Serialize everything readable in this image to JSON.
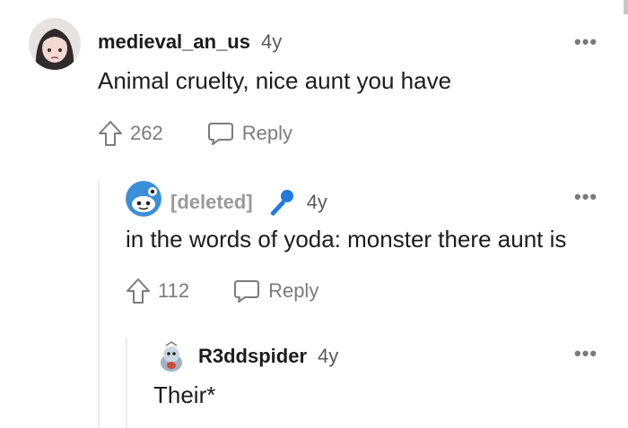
{
  "colors": {
    "text": "#1c1c1c",
    "meta": "#5b5b5b",
    "action": "#7c7c7c",
    "deleted": "#9a9a9a",
    "mic": "#1f7ae0",
    "thread_line": "#ededed"
  },
  "comments": [
    {
      "username": "medieval_an_us",
      "age": "4y",
      "body": "Animal cruelty, nice aunt you have",
      "upvotes": "262",
      "reply_label": "Reply",
      "more_label": "•••",
      "avatar_icon": "anime-girl-avatar"
    },
    {
      "username": "[deleted]",
      "age": "4y",
      "body": "in the words of yoda: monster there aunt is",
      "upvotes": "112",
      "reply_label": "Reply",
      "more_label": "•••",
      "avatar_icon": "reddit-snoo-avatar",
      "flair_icon": "microphone-icon"
    },
    {
      "username": "R3ddspider",
      "age": "4y",
      "body": "Their*",
      "more_label": "•••",
      "avatar_icon": "spider-snoo-avatar"
    }
  ]
}
